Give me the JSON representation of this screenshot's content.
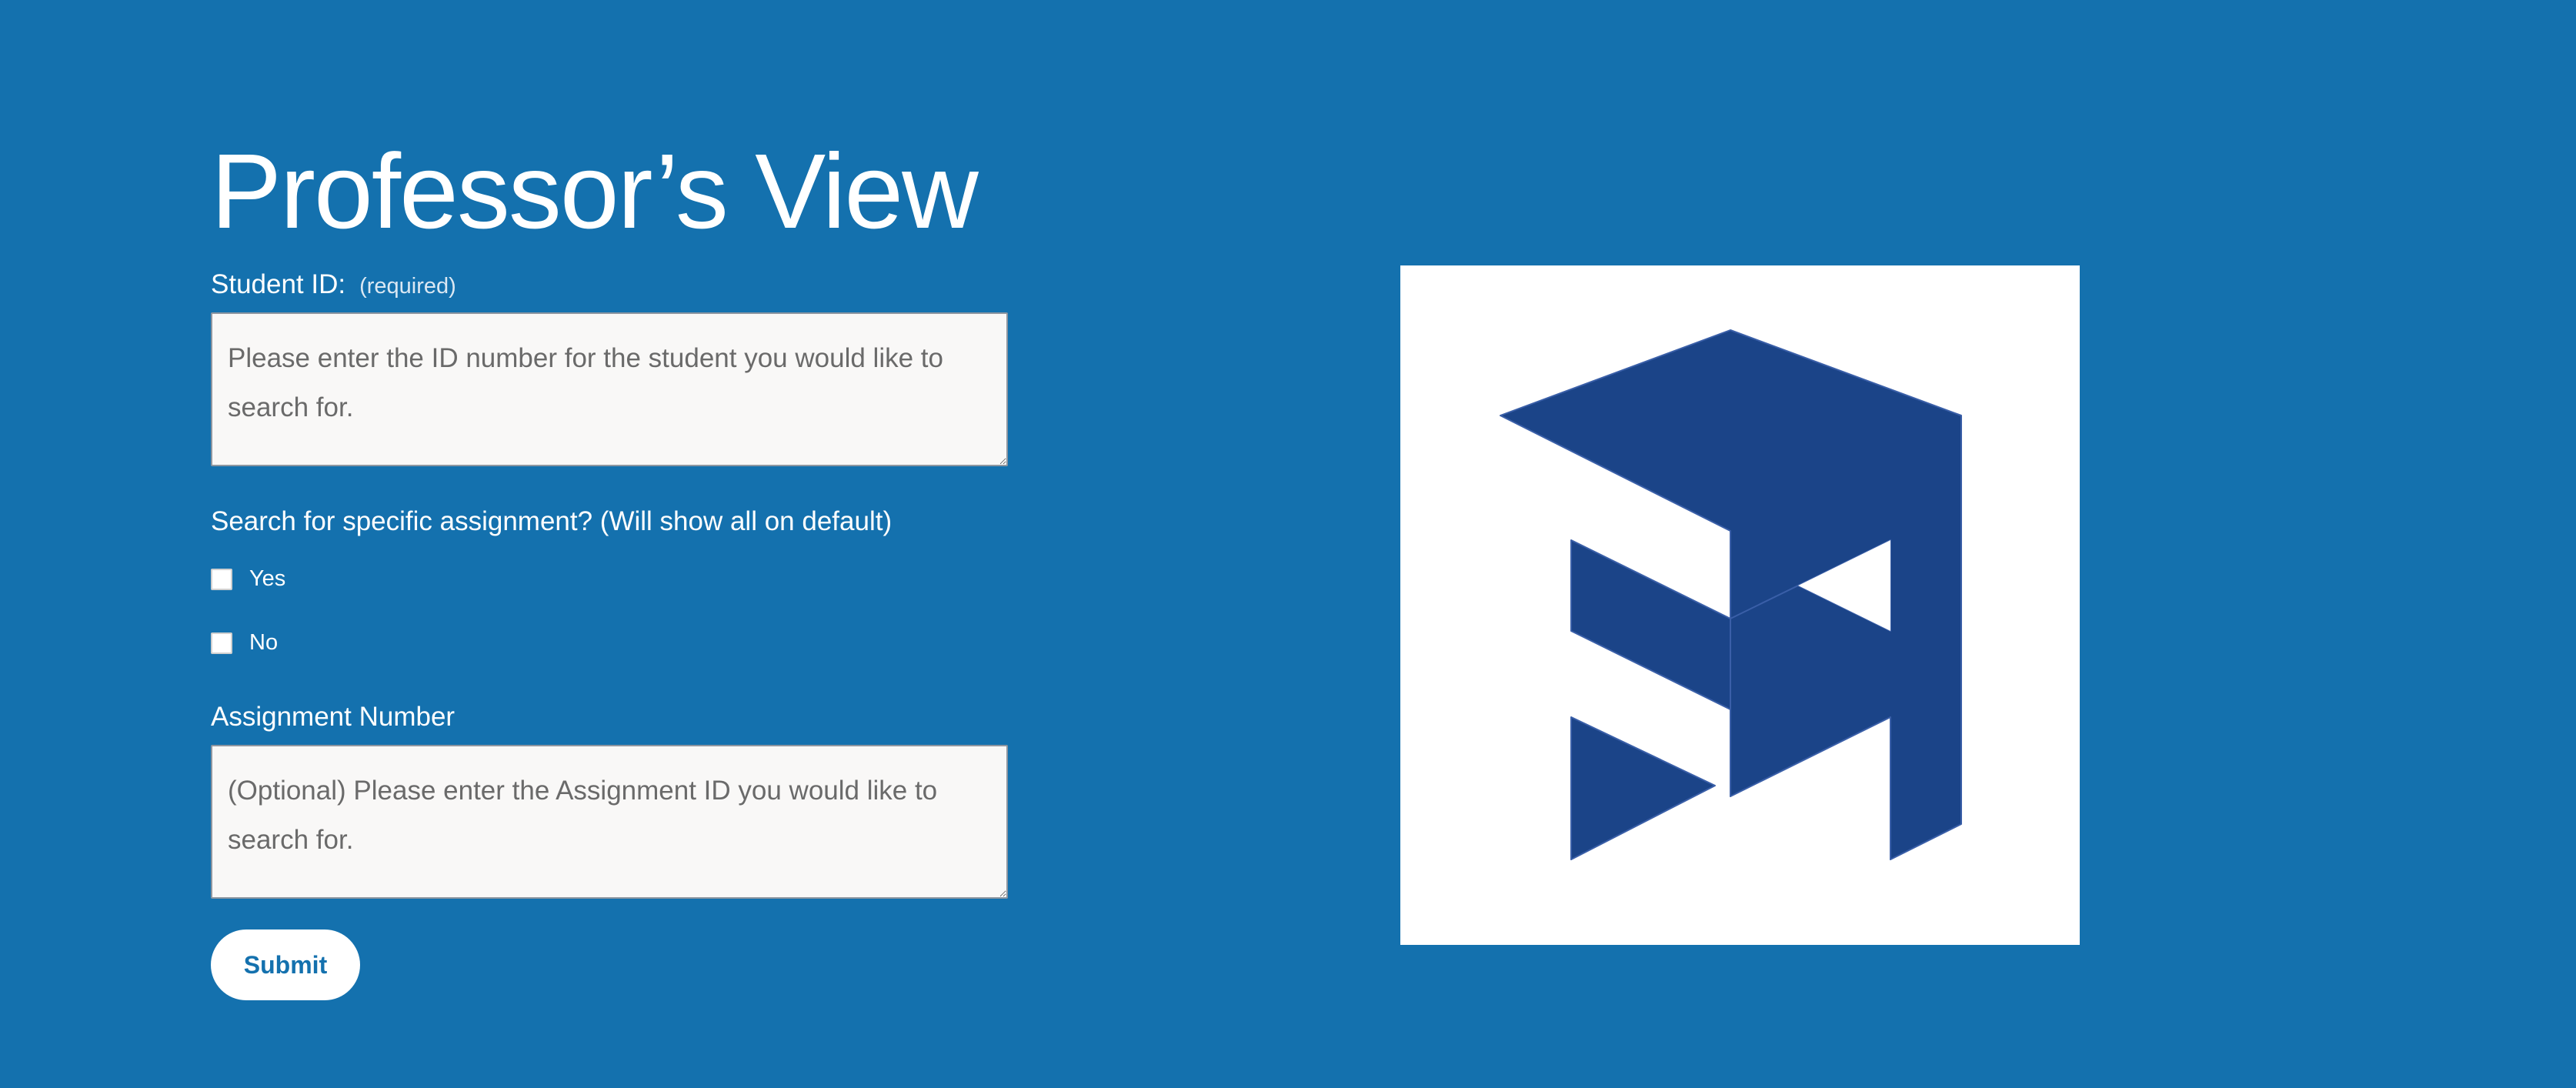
{
  "page": {
    "title": "Professor’s View",
    "background_color": "#1471ae"
  },
  "student_id": {
    "label": "Student ID:",
    "required_note": "(required)",
    "placeholder": "Please enter the ID number for the student you would like to search for."
  },
  "assignment_filter": {
    "question": "Search for specific assignment? (Will show all on default)",
    "options": [
      {
        "label": "Yes",
        "checked": false
      },
      {
        "label": "No",
        "checked": false
      }
    ]
  },
  "assignment_number": {
    "label": "Assignment Number",
    "placeholder": "(Optional) Please enter the Assignment ID you would like to search for."
  },
  "submit": {
    "label": "Submit"
  },
  "logo": {
    "icon": "isometric-block-logo-icon",
    "color": "#1b4488",
    "background": "#ffffff"
  }
}
